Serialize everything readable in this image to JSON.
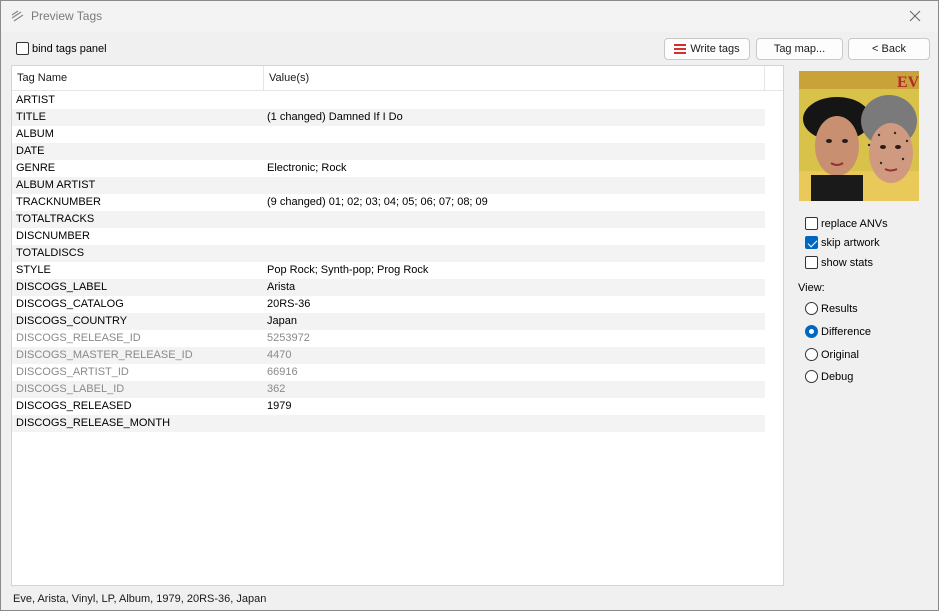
{
  "window": {
    "title": "Preview Tags"
  },
  "toolbar": {
    "bind_tags_panel": {
      "label": "bind tags panel",
      "checked": false
    },
    "write_tags_label": "Write tags",
    "tag_map_label": "Tag map...",
    "back_label": "< Back"
  },
  "table": {
    "columns": [
      "Tag Name",
      "Value(s)"
    ],
    "rows": [
      {
        "name": "ARTIST",
        "value": "",
        "dim": false
      },
      {
        "name": "TITLE",
        "value": "(1 changed) Damned If I Do",
        "dim": false
      },
      {
        "name": "ALBUM",
        "value": "",
        "dim": false
      },
      {
        "name": "DATE",
        "value": "",
        "dim": false
      },
      {
        "name": "GENRE",
        "value": "Electronic; Rock",
        "dim": false
      },
      {
        "name": "ALBUM ARTIST",
        "value": "",
        "dim": false
      },
      {
        "name": "TRACKNUMBER",
        "value": "(9 changed) 01; 02; 03; 04; 05; 06; 07; 08; 09",
        "dim": false
      },
      {
        "name": "TOTALTRACKS",
        "value": "",
        "dim": false
      },
      {
        "name": "DISCNUMBER",
        "value": "",
        "dim": false
      },
      {
        "name": "TOTALDISCS",
        "value": "",
        "dim": false
      },
      {
        "name": "STYLE",
        "value": "Pop Rock; Synth-pop; Prog Rock",
        "dim": false
      },
      {
        "name": "DISCOGS_LABEL",
        "value": "Arista",
        "dim": false
      },
      {
        "name": "DISCOGS_CATALOG",
        "value": "20RS-36",
        "dim": false
      },
      {
        "name": "DISCOGS_COUNTRY",
        "value": "Japan",
        "dim": false
      },
      {
        "name": "DISCOGS_RELEASE_ID",
        "value": "5253972",
        "dim": true
      },
      {
        "name": "DISCOGS_MASTER_RELEASE_ID",
        "value": "4470",
        "dim": true
      },
      {
        "name": "DISCOGS_ARTIST_ID",
        "value": "66916",
        "dim": true
      },
      {
        "name": "DISCOGS_LABEL_ID",
        "value": "362",
        "dim": true
      },
      {
        "name": "DISCOGS_RELEASED",
        "value": "1979",
        "dim": false
      },
      {
        "name": "DISCOGS_RELEASE_MONTH",
        "value": "",
        "dim": false
      }
    ]
  },
  "cover": {
    "logo_text": "EVE"
  },
  "options": {
    "replace_anvs": {
      "label": "replace ANVs",
      "checked": false
    },
    "skip_artwork": {
      "label": "skip artwork",
      "checked": true
    },
    "show_stats": {
      "label": "show stats",
      "checked": false
    }
  },
  "view": {
    "label": "View:",
    "options": [
      "Results",
      "Difference",
      "Original",
      "Debug"
    ],
    "selected": "Difference"
  },
  "status": {
    "text": "Eve, Arista, Vinyl, LP, Album, 1979, 20RS-36, Japan"
  },
  "colors": {
    "accent": "#0067c0",
    "write_icon": "#d32f2f",
    "dim_text": "#8a8a8a"
  }
}
